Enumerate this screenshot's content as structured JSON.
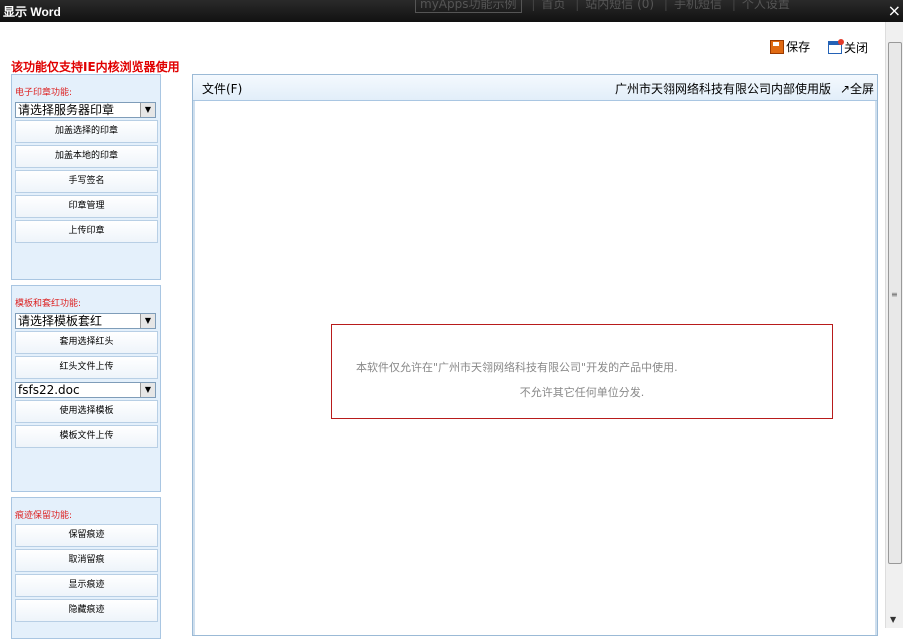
{
  "window": {
    "title": "显示 Word",
    "close_glyph": "×"
  },
  "background_nav": {
    "select_label": "myApps功能示例",
    "items": [
      "首页",
      "站内短信 (0)",
      "手机短信",
      "个人设置"
    ]
  },
  "toolbar": {
    "save_label": "保存",
    "close_label": "关闭"
  },
  "warning": "该功能仅支持IE内核浏览器使用",
  "seal_panel": {
    "title": "电子印章功能:",
    "select_value": "请选择服务器印章",
    "buttons": [
      "加盖选择的印章",
      "加盖本地的印章",
      "手写签名",
      "印章管理",
      "上传印章"
    ]
  },
  "template_panel": {
    "title": "模板和套红功能:",
    "select_value": "请选择模板套红",
    "buttons_a": [
      "套用选择红头",
      "红头文件上传"
    ],
    "select2_value": "fsfs22.doc",
    "buttons_b": [
      "使用选择模板",
      "模板文件上传"
    ]
  },
  "trace_panel": {
    "title": "痕迹保留功能:",
    "buttons": [
      "保留痕迹",
      "取消留痕",
      "显示痕迹",
      "隐藏痕迹"
    ]
  },
  "document": {
    "menu_file": "文件(F)",
    "license": "广州市天翎网络科技有限公司内部使用版",
    "fullscreen": "↗全屏",
    "notice_line1": "本软件仅允许在\"广州市天翎网络科技有限公司\"开发的产品中使用.",
    "notice_line2": "不允许其它任何单位分发."
  },
  "colors": {
    "warning_red": "#e00000",
    "panel_bg": "#e4f0fb",
    "notice_border": "#b81b1b"
  }
}
